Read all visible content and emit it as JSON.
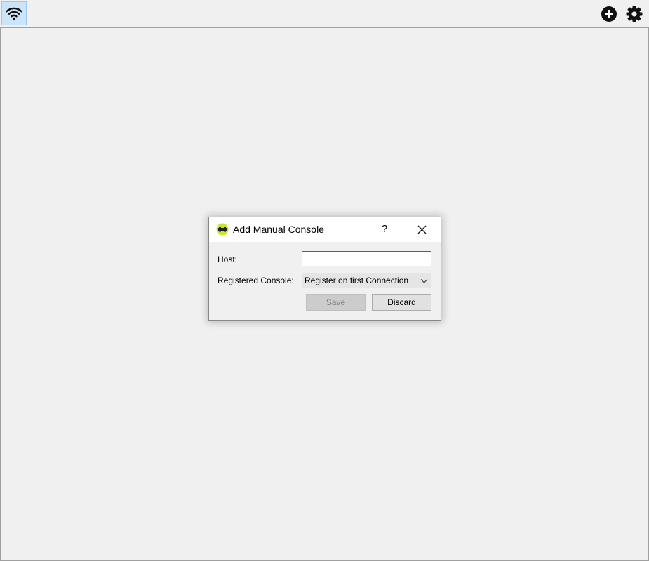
{
  "toolbar": {
    "wifi_icon": "wifi-icon",
    "add_icon": "plus-circle-icon",
    "settings_icon": "gear-icon"
  },
  "dialog": {
    "title": "Add Manual Console",
    "help_label": "?",
    "host_label": "Host:",
    "host_value": "",
    "registered_label": "Registered Console:",
    "registered_selected": "Register on first Connection",
    "save_label": "Save",
    "discard_label": "Discard"
  },
  "colors": {
    "background": "#f0f0f0",
    "wifi_active_bg": "#cce4f7",
    "input_focus_border": "#0078d7",
    "disabled_button_bg": "#cccccc"
  }
}
